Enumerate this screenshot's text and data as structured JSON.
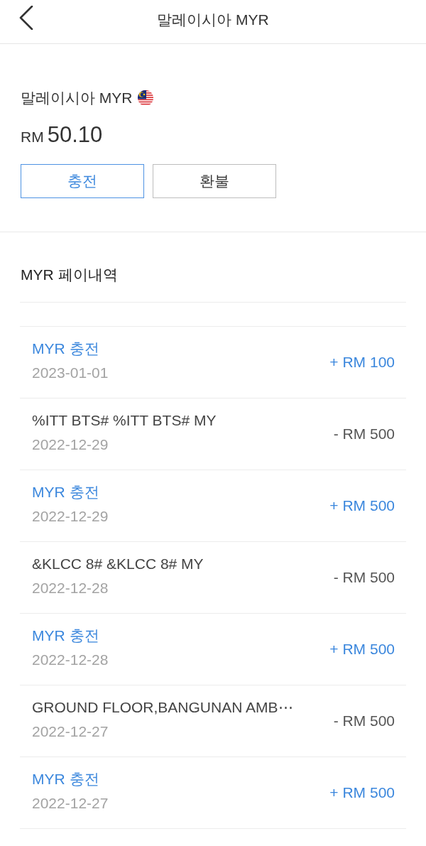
{
  "header": {
    "title": "말레이시아 MYR"
  },
  "wallet": {
    "name": "말레이시아 MYR",
    "currency_symbol": "RM",
    "balance": "50.10",
    "buttons": [
      {
        "label": "충전",
        "kind": "topup"
      },
      {
        "label": "환불",
        "kind": "refund"
      }
    ]
  },
  "history": {
    "title": "MYR 페이내역",
    "rows": [
      {
        "kind": "topup",
        "title": "MYR 충전",
        "date": "2023-01-01",
        "amount": "+ RM 100"
      },
      {
        "kind": "payment",
        "title": "%ITT BTS# %ITT BTS# MY",
        "date": "2022-12-29",
        "amount": "- RM 500"
      },
      {
        "kind": "topup",
        "title": "MYR 충전",
        "date": "2022-12-29",
        "amount": "+ RM 500"
      },
      {
        "kind": "payment",
        "title": "&KLCC 8# &KLCC 8# MY",
        "date": "2022-12-28",
        "amount": "- RM 500"
      },
      {
        "kind": "topup",
        "title": "MYR 충전",
        "date": "2022-12-28",
        "amount": "+ RM 500"
      },
      {
        "kind": "payment",
        "title": "GROUND FLOOR,BANGUNAN AMB⋯",
        "date": "2022-12-27",
        "amount": "- RM 500"
      },
      {
        "kind": "topup",
        "title": "MYR 충전",
        "date": "2022-12-27",
        "amount": "+ RM 500"
      }
    ]
  }
}
